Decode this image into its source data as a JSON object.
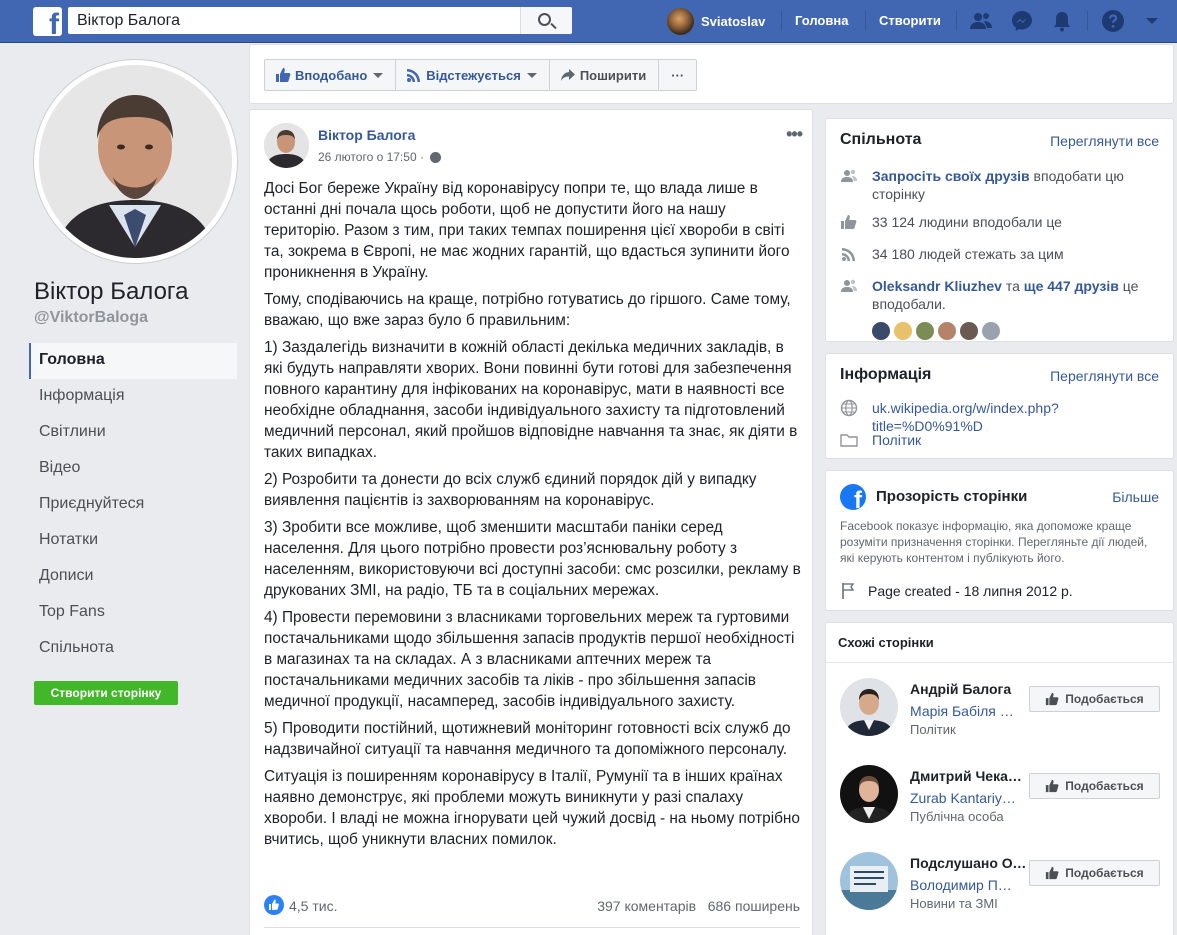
{
  "topbar": {
    "logo": "f",
    "search_value": "Віктор Балога",
    "user_name": "Sviatoslav",
    "home": "Головна",
    "create": "Створити",
    "icons": [
      "friends-icon",
      "messenger-icon",
      "notifications-icon",
      "help-icon",
      "dropdown-icon"
    ]
  },
  "page": {
    "name": "Віктор Балога",
    "handle": "@ViktorBaloga"
  },
  "left_nav": [
    "Головна",
    "Інформація",
    "Світлини",
    "Відео",
    "Приєднуйтеся",
    "Нотатки",
    "Дописи",
    "Top Fans",
    "Спільнота"
  ],
  "create_page": "Створити сторінку",
  "actions": {
    "liked": "Вподобано",
    "following": "Відстежується",
    "share": "Поширити",
    "more": "···"
  },
  "post": {
    "author": "Віктор Балога",
    "time": "26 лютого о 17:50 ·",
    "more": "•••",
    "paragraphs": [
      "Досі Бог береже Україну від коронавірусу попри те, що влада лише в останні дні почала щось роботи, щоб не допустити його на нашу територію. Разом з тим, при таких темпах поширення цієї хвороби в світі та, зокрема в Європі, не має жодних гарантій, що вдасться зупинити його проникнення в Україну.",
      "Тому, сподіваючись на краще, потрібно готуватись до гіршого. Саме тому, вважаю, що вже зараз було б правильним:",
      "1) Заздалегідь визначити в кожній області декілька медичних закладів, в які будуть направляти хворих. Вони повинні бути готові для забезпечення повного карантину для інфікованих на коронавірус, мати в наявності все необхідне обладнання, засоби індивідуального захисту та підготовлений медичний персонал, який пройшов відповідне навчання та знає, як діяти в таких випадках.",
      "2) Розробити та донести до всіх служб єдиний порядок дій у випадку виявлення пацієнтів із захворюванням на коронавірус.",
      "3) Зробити все можливе, щоб зменшити масштаби паніки серед населення. Для цього потрібно провести роз’яснювальну роботу з населенням, використовуючи всі доступні засоби: смс розсилки, рекламу в друкованих ЗМІ, на радіо, ТБ та в соціальних мережах.",
      "4) Провести перемовини з власниками торговельних мереж та гуртовими постачальниками щодо збільшення запасів продуктів першої необхідності в магазинах та на складах. А з власниками аптечних мереж та постачальниками медичних засобів та ліків - про збільшення запасів медичної продукції, насамперед, засобів індивідуального захисту.",
      "5) Проводити постійний, щотижневий моніторинг готовності всіх служб до надзвичайної ситуації та навчання медичного та допоміжного персоналу.",
      "Ситуація із поширенням коронавірусу в Італії, Румунії та в інших країнах наявно демонструє, які проблеми можуть виникнути у разі спалаху хвороби. І владі не можна ігнорувати цей чужий досвід - на ньому потрібно вчитись, щоб уникнути власних помилок."
    ],
    "likes": "4,5 тис.",
    "comments": "397 коментарів",
    "shares": "686 поширень"
  },
  "community": {
    "title": "Спільнота",
    "see_all": "Переглянути все",
    "invite_link": "Запросіть своїх друзів",
    "invite_rest": " вподобати цю сторінку",
    "likes": "33 124 людини вподобали це",
    "follows": "34 180 людей стежать за цим",
    "friend_name": "Oleksandr Kliuzhev",
    "friend_and": " та ",
    "friend_more": "ще 447 друзів",
    "friend_rest": " це вподобали."
  },
  "info": {
    "title": "Інформація",
    "see_all": "Переглянути все",
    "website": "uk.wikipedia.org/w/index.php?title=%D0%91%D",
    "category": "Політик"
  },
  "transparency": {
    "title": "Прозорість сторінки",
    "more": "Більше",
    "desc": "Facebook показує інформацію, яка допоможе краще розуміти призначення сторінки. Перегляньте дії людей, які керують контентом і публікують його.",
    "created": "Page created - 18 липня 2012 р."
  },
  "similar": {
    "title": "Схожі сторінки",
    "like_label": "Подобається",
    "items": [
      {
        "name": "Андрій Балога",
        "sub": "Марія Бабіля вподобала",
        "cat": "Політик"
      },
      {
        "name": "Дмитрий Чекалкин",
        "sub": "Zurab Kantariya вподобав",
        "cat": "Публічна особа"
      },
      {
        "name": "Подслушано Одесса",
        "sub": "Володимир Пилипенко",
        "cat": "Новини та ЗМІ"
      }
    ]
  },
  "colors": {
    "fb_blue": "#4267b2",
    "link": "#365899",
    "green": "#42b72a"
  }
}
